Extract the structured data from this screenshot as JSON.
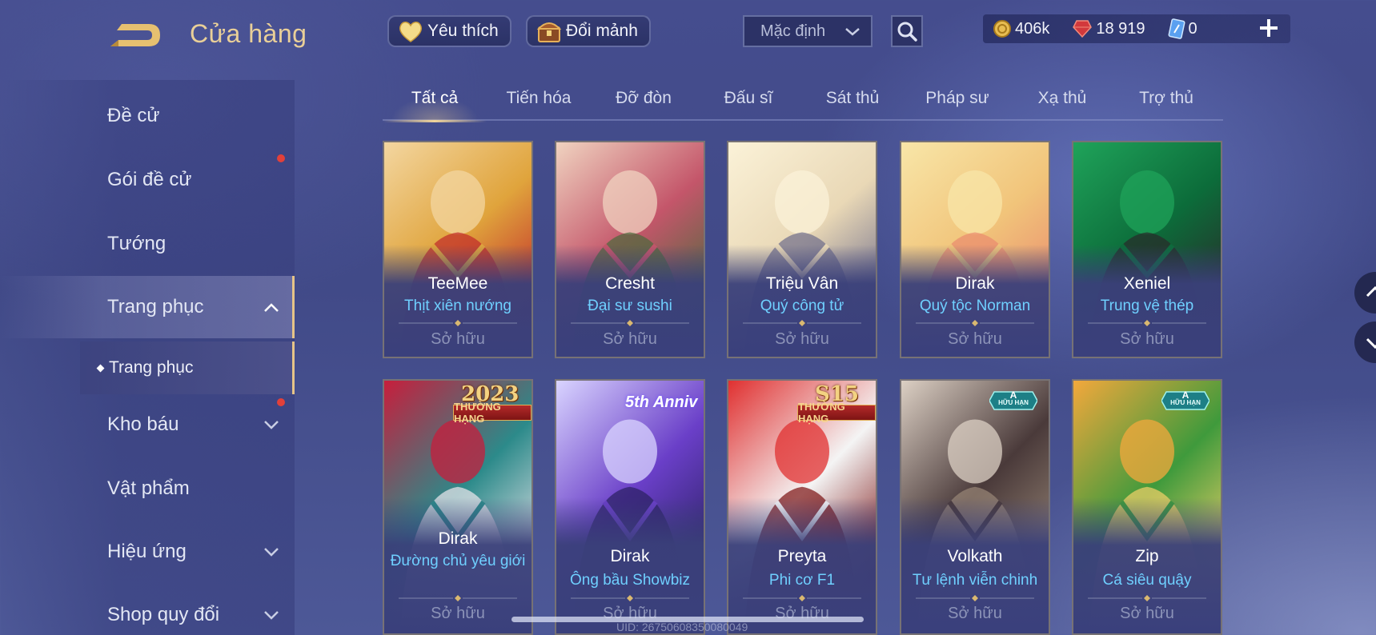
{
  "header": {
    "title": "Cửa hàng",
    "favorites_label": "Yêu thích",
    "exchange_label": "Đổi mảnh",
    "sort_value": "Mặc định",
    "currencies": [
      {
        "icon": "gold-coin-icon",
        "value": "406k"
      },
      {
        "icon": "red-gem-icon",
        "value": "18 919"
      },
      {
        "icon": "voucher-icon",
        "value": "0"
      }
    ]
  },
  "sidebar": {
    "items": [
      {
        "label": "Đề cử"
      },
      {
        "label": "Gói đề cử"
      },
      {
        "label": "Tướng"
      },
      {
        "label": "Trang phục"
      },
      {
        "label": "Kho báu"
      },
      {
        "label": "Vật phẩm"
      },
      {
        "label": "Hiệu ứng"
      },
      {
        "label": "Shop quy đổi"
      }
    ],
    "sub_item": "Trang phục"
  },
  "tabs": [
    {
      "label": "Tất cả"
    },
    {
      "label": "Tiến hóa"
    },
    {
      "label": "Đỡ đòn"
    },
    {
      "label": "Đấu sĩ"
    },
    {
      "label": "Sát thủ"
    },
    {
      "label": "Pháp sư"
    },
    {
      "label": "Xạ thủ"
    },
    {
      "label": "Trợ thủ"
    }
  ],
  "cards": [
    {
      "hero": "TeeMee",
      "skin": "Thịt xiên nướng",
      "status": "Sở hữu",
      "palette": [
        "#f3d6a0",
        "#e0a43c",
        "#c0282a"
      ]
    },
    {
      "hero": "Cresht",
      "skin": "Đại sư sushi",
      "status": "Sở hữu",
      "palette": [
        "#f0d3c0",
        "#c4566a",
        "#4a6a3c"
      ]
    },
    {
      "hero": "Triệu Vân",
      "skin": "Quý công tử",
      "status": "Sở hữu",
      "palette": [
        "#fbf2d8",
        "#e9d8b6",
        "#6e6c8a"
      ]
    },
    {
      "hero": "Dirak",
      "skin": "Quý tộc Norman",
      "status": "Sở hữu",
      "palette": [
        "#f8e6a8",
        "#f1c47a",
        "#e98a6e"
      ]
    },
    {
      "hero": "Xeniel",
      "skin": "Trung vệ thép",
      "status": "Sở hữu",
      "palette": [
        "#1fa35a",
        "#0c6c3a",
        "#2a2a2a"
      ]
    },
    {
      "hero": "Dirak",
      "skin": "Đường chủ yêu giới",
      "status": "Sở hữu",
      "palette": [
        "#c71e3c",
        "#2c8a8a",
        "#f0e8ee"
      ],
      "badge_year": "2023",
      "ribbon": "THƯỜNG HẠNG"
    },
    {
      "hero": "Dirak",
      "skin": "Ông bầu Showbiz",
      "status": "Sở hữu",
      "palette": [
        "#d9d4ff",
        "#6a3fc8",
        "#2a2060"
      ],
      "badge_anniv": "5th Anniv"
    },
    {
      "hero": "Preyta",
      "skin": "Phi cơ F1",
      "status": "Sở hữu",
      "palette": [
        "#e03030",
        "#f4f4f4",
        "#7a0f0f"
      ],
      "badge_year": "S15",
      "ribbon": "THƯỜNG HẠNG"
    },
    {
      "hero": "Volkath",
      "skin": "Tư lệnh viễn chinh",
      "status": "Sở hữu",
      "palette": [
        "#dcd0c4",
        "#4a3a3a",
        "#9a8878"
      ],
      "badge_limited": "A",
      "badge_limited_sub": "HỮU HẠN"
    },
    {
      "hero": "Zip",
      "skin": "Cá siêu quậy",
      "status": "Sở hữu",
      "palette": [
        "#f3a83c",
        "#3f9a3c",
        "#f6d26a"
      ],
      "badge_limited": "A",
      "badge_limited_sub": "HỮU HẠN"
    }
  ],
  "footer": {
    "uid": "UID: 26750608350080049"
  }
}
